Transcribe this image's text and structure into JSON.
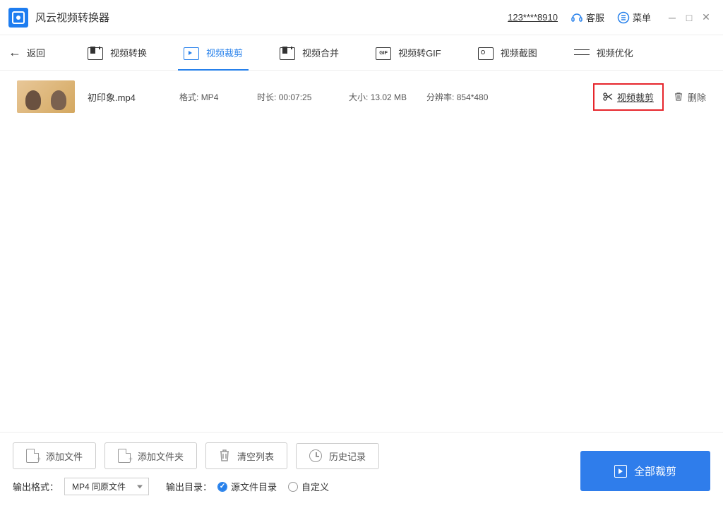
{
  "titlebar": {
    "app_name": "风云视频转换器",
    "account": "123****8910",
    "support": "客服",
    "menu": "菜单"
  },
  "nav": {
    "back": "返回",
    "tabs": {
      "convert": "视频转换",
      "crop": "视频裁剪",
      "merge": "视频合并",
      "gif": "视频转GIF",
      "screenshot": "视频截图",
      "optimize": "视频优化"
    }
  },
  "file": {
    "name": "初印象.mp4",
    "format_label": "格式:",
    "format": "MP4",
    "duration_label": "时长:",
    "duration": "00:07:25",
    "size_label": "大小:",
    "size": "13.02 MB",
    "resolution_label": "分辨率:",
    "resolution": "854*480",
    "crop_action": "视频裁剪",
    "delete_action": "删除"
  },
  "footer": {
    "add_file": "添加文件",
    "add_folder": "添加文件夹",
    "clear_list": "清空列表",
    "history": "历史记录",
    "output_format_label": "输出格式：",
    "output_format_value": "MP4 同原文件",
    "output_dir_label": "输出目录：",
    "dir_source": "源文件目录",
    "dir_custom": "自定义",
    "main_action": "全部裁剪"
  }
}
